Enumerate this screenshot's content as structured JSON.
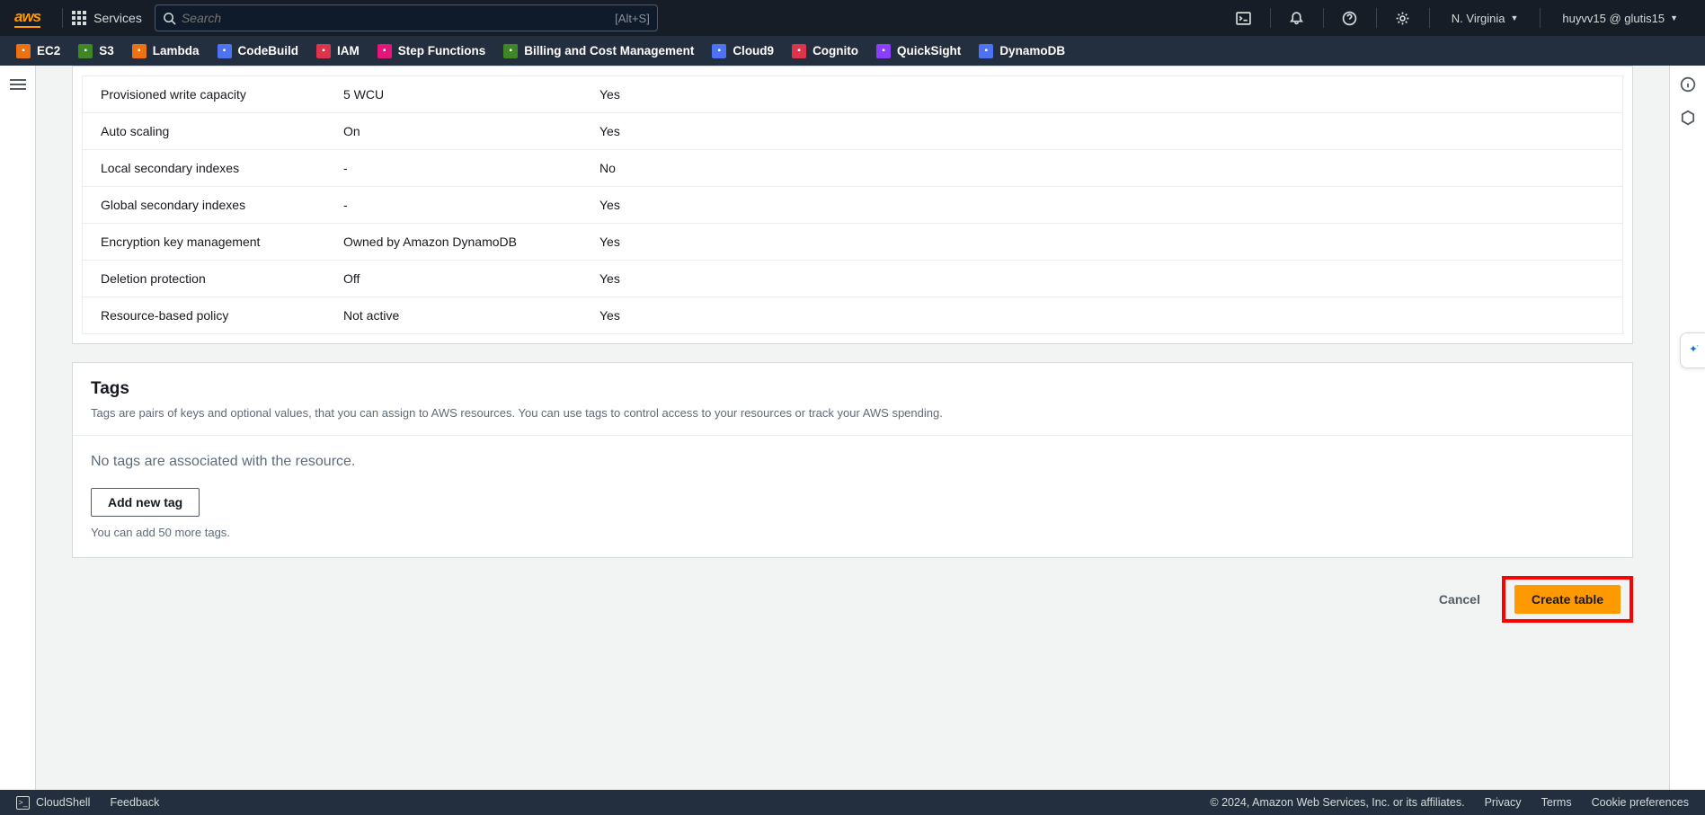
{
  "header": {
    "services_label": "Services",
    "search_placeholder": "Search",
    "search_hint": "[Alt+S]",
    "region": "N. Virginia",
    "account": "huyvv15 @ glutis15"
  },
  "toolbar": [
    {
      "label": "EC2",
      "color": "#ec7211"
    },
    {
      "label": "S3",
      "color": "#3f8624"
    },
    {
      "label": "Lambda",
      "color": "#ec7211"
    },
    {
      "label": "CodeBuild",
      "color": "#4d72f3"
    },
    {
      "label": "IAM",
      "color": "#dd344c"
    },
    {
      "label": "Step Functions",
      "color": "#e7157b"
    },
    {
      "label": "Billing and Cost Management",
      "color": "#3f8624"
    },
    {
      "label": "Cloud9",
      "color": "#4d72f3"
    },
    {
      "label": "Cognito",
      "color": "#dd344c"
    },
    {
      "label": "QuickSight",
      "color": "#8a3ffc"
    },
    {
      "label": "DynamoDB",
      "color": "#4d72f3"
    }
  ],
  "settings_table": {
    "rows": [
      {
        "name": "Provisioned write capacity",
        "value": "5 WCU",
        "editable": "Yes"
      },
      {
        "name": "Auto scaling",
        "value": "On",
        "editable": "Yes"
      },
      {
        "name": "Local secondary indexes",
        "value": "-",
        "editable": "No"
      },
      {
        "name": "Global secondary indexes",
        "value": "-",
        "editable": "Yes"
      },
      {
        "name": "Encryption key management",
        "value": "Owned by Amazon DynamoDB",
        "editable": "Yes"
      },
      {
        "name": "Deletion protection",
        "value": "Off",
        "editable": "Yes"
      },
      {
        "name": "Resource-based policy",
        "value": "Not active",
        "editable": "Yes"
      }
    ]
  },
  "tags_panel": {
    "title": "Tags",
    "description": "Tags are pairs of keys and optional values, that you can assign to AWS resources. You can use tags to control access to your resources or track your AWS spending.",
    "empty_msg": "No tags are associated with the resource.",
    "add_button": "Add new tag",
    "limit_hint": "You can add 50 more tags."
  },
  "actions": {
    "cancel": "Cancel",
    "create": "Create table"
  },
  "footer": {
    "cloudshell": "CloudShell",
    "feedback": "Feedback",
    "copyright": "© 2024, Amazon Web Services, Inc. or its affiliates.",
    "privacy": "Privacy",
    "terms": "Terms",
    "cookie": "Cookie preferences"
  }
}
